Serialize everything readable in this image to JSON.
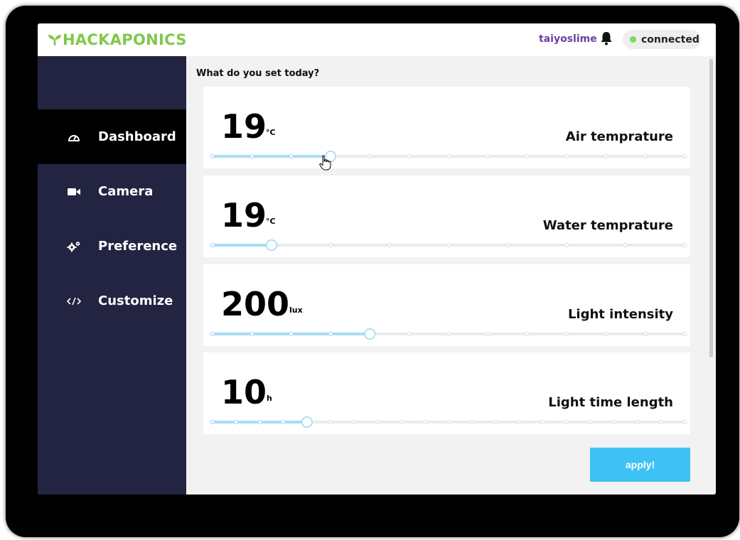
{
  "app": {
    "logo_text": "HACKAPONICS"
  },
  "header": {
    "username": "taiyoslime",
    "status": "connected",
    "status_color": "#7ed957"
  },
  "sidebar": {
    "items": [
      {
        "label": "Dashboard",
        "icon": "gauge-icon",
        "active": true
      },
      {
        "label": "Camera",
        "icon": "video-camera-icon",
        "active": false
      },
      {
        "label": "Preference",
        "icon": "gears-icon",
        "active": false
      },
      {
        "label": "Customize",
        "icon": "code-icon",
        "active": false
      }
    ]
  },
  "main": {
    "title": "What do you set today?",
    "settings": [
      {
        "value": "19",
        "unit": "°C",
        "label": "Air temprature",
        "ticks": 13,
        "position": 3
      },
      {
        "value": "19",
        "unit": "°C",
        "label": "Water temprature",
        "ticks": 9,
        "position": 1
      },
      {
        "value": "200",
        "unit": "lux",
        "label": "Light intensity",
        "ticks": 13,
        "position": 4
      },
      {
        "value": "10",
        "unit": "h",
        "label": "Light time length",
        "ticks": 21,
        "position": 4
      }
    ],
    "apply_label": "apply!"
  },
  "colors": {
    "accent": "#3ec1f5",
    "slider_fill": "#a8dcf5",
    "sidebar_bg": "#232441",
    "logo": "#7fc94a"
  }
}
